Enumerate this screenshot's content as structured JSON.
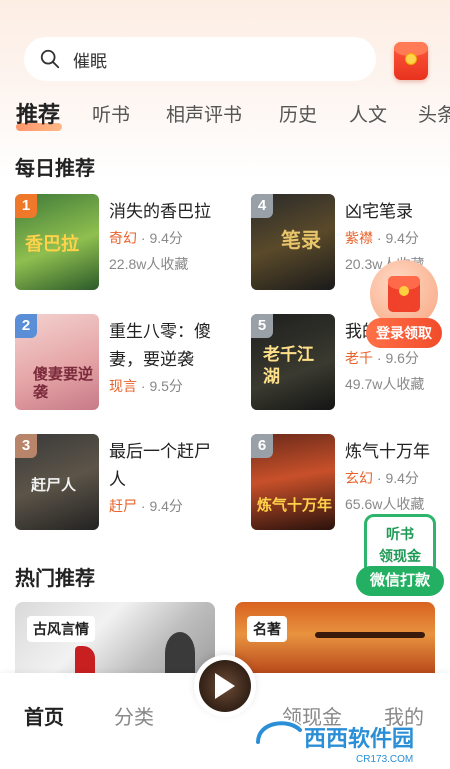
{
  "search": {
    "query": "催眠"
  },
  "tabs": [
    "推荐",
    "听书",
    "相声评书",
    "历史",
    "人文",
    "头条"
  ],
  "daily": {
    "title": "每日推荐",
    "books": [
      {
        "rank": "1",
        "title": "消失的香巴拉",
        "category": "奇幻",
        "score": "9.4分",
        "favorites": "22.8w人收藏",
        "cover_text": "香巴拉"
      },
      {
        "rank": "4",
        "title": "凶宅笔录",
        "category": "紫襟",
        "score": "9.4分",
        "favorites": "20.3w人收藏",
        "cover_text": "笔录"
      },
      {
        "rank": "2",
        "title": "重生八零：傻妻，要逆袭",
        "category": "现言",
        "score": "9.5分",
        "favorites": "",
        "cover_text": "傻妻要逆袭"
      },
      {
        "rank": "5",
        "title": "我的老千江湖",
        "category": "老千",
        "score": "9.6分",
        "favorites": "49.7w人收藏",
        "cover_text": "老千江湖"
      },
      {
        "rank": "3",
        "title": "最后一个赶尸人",
        "category": "赶尸",
        "score": "9.4分",
        "favorites": "",
        "cover_text": "赶尸人"
      },
      {
        "rank": "6",
        "title": "炼气十万年",
        "category": "玄幻",
        "score": "9.4分",
        "favorites": "65.6w人收藏",
        "cover_text": "炼气十万年"
      }
    ]
  },
  "promo_redpack": {
    "label": "登录领取"
  },
  "promo_listen": {
    "line1": "听书",
    "line2": "领现金",
    "button": "微信打款"
  },
  "hot": {
    "title": "热门推荐",
    "cards": [
      {
        "tag": "古风言情"
      },
      {
        "tag": "名著"
      }
    ]
  },
  "nav": {
    "home": "首页",
    "category": "分类",
    "cash": "领现金",
    "mine": "我的"
  },
  "watermark": {
    "brand": "西西软件园",
    "url": "CR173.COM"
  },
  "colors": {
    "accent": "#e8622a",
    "green": "#23b063"
  }
}
